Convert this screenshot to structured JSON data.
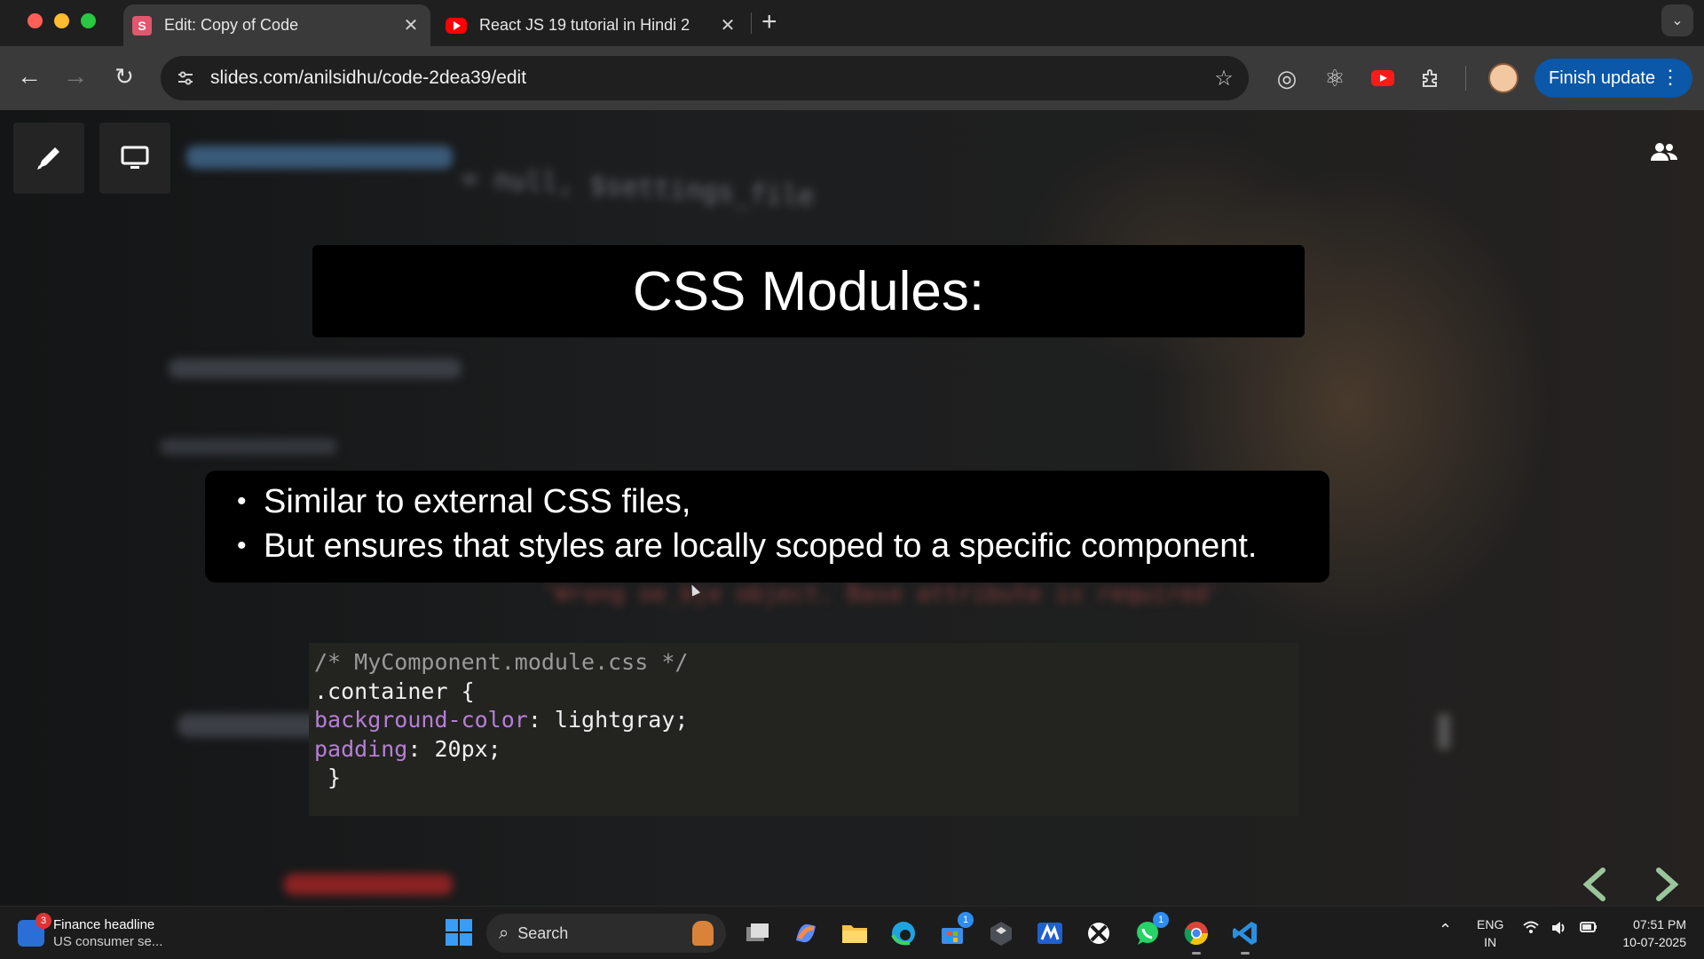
{
  "browser": {
    "tabs": [
      {
        "title": "Edit: Copy of Code",
        "favicon_letter": "S",
        "active": true
      },
      {
        "title": "React JS 19 tutorial in Hindi 2",
        "active": false
      }
    ],
    "address": "slides.com/anilsidhu/code-2dea39/edit",
    "finish_update_label": "Finish update"
  },
  "slide": {
    "title": "CSS Modules:",
    "bullets": [
      "Similar to external CSS files,",
      "But ensures that styles are locally scoped to a specific component."
    ],
    "code": {
      "comment": "/* MyComponent.module.css */",
      "selector": ".container {",
      "lines": [
        {
          "prop": "background-color",
          "value": ": lightgray;"
        },
        {
          "prop": "padding",
          "value": ": 20px;"
        }
      ],
      "close": " }"
    },
    "background_code_text": "= null, $settings_file",
    "background_error_text": "'Wrong oe_bje object. Base attribute is required'"
  },
  "taskbar": {
    "widget_badge": "3",
    "widget_title": "Finance headline",
    "widget_subtitle": "US consumer se...",
    "search_label": "Search",
    "store_badge": "1",
    "whatsapp_badge": "1",
    "lang_line1": "ENG",
    "lang_line2": "IN",
    "time": "07:51 PM",
    "date": "10-07-2025"
  },
  "colors": {
    "accent_blue": "#0b57a8",
    "code_property": "#b57fd6",
    "code_comment": "#9a9a9a"
  }
}
